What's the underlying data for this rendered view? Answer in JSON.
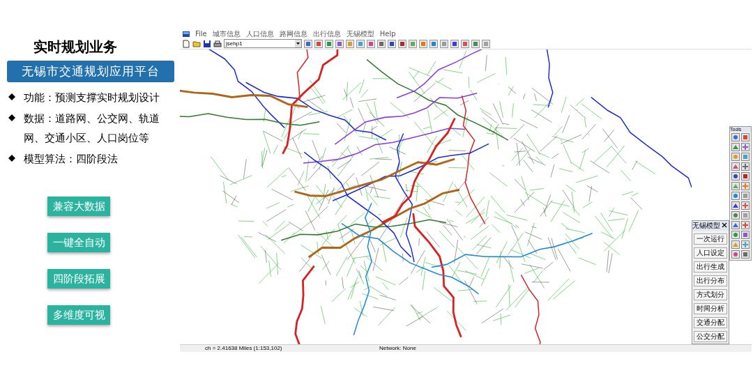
{
  "slide": {
    "title": "实时规划业务",
    "banner": "无锡市交通规划应用平台",
    "bullets": [
      "功能：预测支撑实时规划设计",
      "数据：道路网、公交网、轨道网、交通小区、人口岗位等",
      "模型算法：四阶段法"
    ],
    "feature_buttons": [
      "兼容大数据",
      "一键全自动",
      "四阶段拓展",
      "多维度可视"
    ]
  },
  "app": {
    "menu": [
      "File",
      "城市信息",
      "人口信息",
      "路网信息",
      "出行信息",
      "无锡模型",
      "Help"
    ],
    "layer_dropdown": {
      "value": "jsehp1"
    },
    "model_panel": {
      "title": "无锡模型",
      "buttons": [
        "一次运行",
        "人口设定",
        "出行生成",
        "出行分布",
        "方式划分",
        "时间分析",
        "交通分配",
        "公交分配"
      ]
    },
    "tools_palette": {
      "title": "Tools"
    },
    "status_bar": {
      "scale": "ch = 2.41638 Miles (1:153,102)",
      "network": "Network: None"
    }
  }
}
